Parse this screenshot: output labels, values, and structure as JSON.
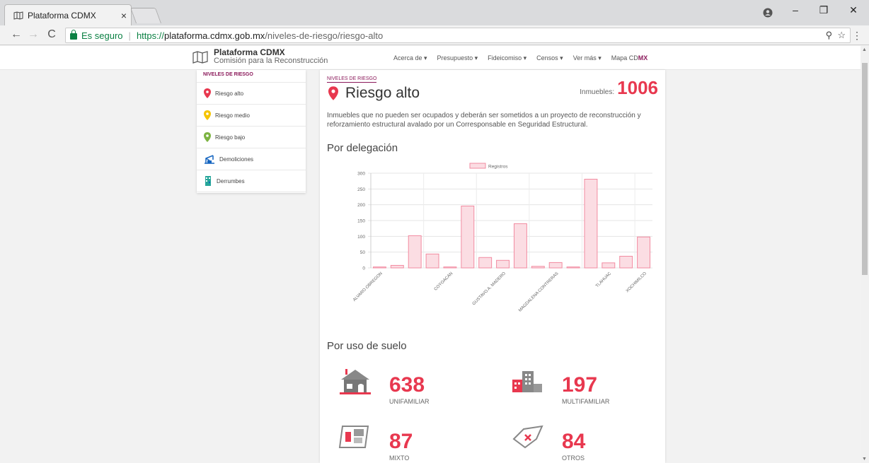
{
  "browser": {
    "tab_title": "Plataforma CDMX",
    "tab_close": "×",
    "secure_label": "Es seguro",
    "url_scheme": "https://",
    "url_host": "plataforma.cdmx.gob.mx",
    "url_path": "/niveles-de-riesgo/riesgo-alto"
  },
  "site": {
    "brand_title": "Plataforma CDMX",
    "brand_subtitle": "Comisión para la Reconstrucción",
    "nav": [
      {
        "label": "Acerca de ▾"
      },
      {
        "label": "Presupuesto ▾"
      },
      {
        "label": "Fideicomiso ▾"
      },
      {
        "label": "Censos ▾"
      },
      {
        "label": "Ver más ▾"
      }
    ],
    "nav_mapa": "Mapa CD",
    "nav_mapa_mx": "MX"
  },
  "sidebar": {
    "title": "NIVELES DE RIESGO",
    "items": [
      {
        "label": "Riesgo alto",
        "icon": "pin-red-icon",
        "color": "#e8384f"
      },
      {
        "label": "Riesgo medio",
        "icon": "pin-yellow-icon",
        "color": "#f5c400"
      },
      {
        "label": "Riesgo bajo",
        "icon": "pin-green-icon",
        "color": "#7cb342"
      },
      {
        "label": "Demoliciones",
        "icon": "crane-icon",
        "color": "#1565c0"
      },
      {
        "label": "Derrumbes",
        "icon": "rubble-icon",
        "color": "#26a69a"
      }
    ]
  },
  "main": {
    "breadcrumb": "NIVELES DE RIESGO",
    "title": "Riesgo alto",
    "count_label": "Inmuebles:",
    "count_value": "1006",
    "description": "Inmuebles que no pueden ser ocupados y deberán ser sometidos a un proyecto de reconstrucción y reforzamiento estructural avalado por un Corresponsable en Seguridad Estructural.",
    "section_delegacion": "Por delegación",
    "section_uso": "Por uso de suelo",
    "stats": [
      {
        "value": "638",
        "label": "UNIFAMILIAR",
        "icon": "house-icon"
      },
      {
        "value": "197",
        "label": "MULTIFAMILIAR",
        "icon": "buildings-icon"
      },
      {
        "value": "87",
        "label": "MIXTO",
        "icon": "mixed-use-icon"
      },
      {
        "value": "84",
        "label": "OTROS",
        "icon": "other-use-icon"
      }
    ]
  },
  "colors": {
    "accent": "#e8384f",
    "brand": "#8b1a5b",
    "bar_fill": "#fbdde3",
    "bar_stroke": "#f28ba0"
  },
  "chart_data": {
    "type": "bar",
    "legend": "Registros",
    "legend_position": "top-center",
    "categories": [
      "ALVARO OBREGON",
      "",
      "COYOACAN",
      "",
      "GUSTAVO A. MADERO",
      "",
      "",
      "MAGDALENA CONTRERAS",
      "",
      "",
      "TLAHUAC",
      "",
      "",
      "XOCHIMILCO"
    ],
    "tick_labels": [
      "ALVARO OBREGON",
      "COYOACAN",
      "GUSTAVO A. MADERO",
      "MAGDALENA CONTRERAS",
      "TLAHUAC",
      "XOCHIMILCO"
    ],
    "series": [
      {
        "name": "Registros",
        "values": [
          3,
          8,
          102,
          44,
          3,
          196,
          33,
          24,
          140,
          5,
          17,
          3,
          281,
          16,
          37,
          98
        ]
      }
    ],
    "y_ticks": [
      "0",
      "50",
      "100",
      "150",
      "200",
      "250",
      "300"
    ],
    "ylim": [
      0,
      300
    ],
    "grid": true
  }
}
